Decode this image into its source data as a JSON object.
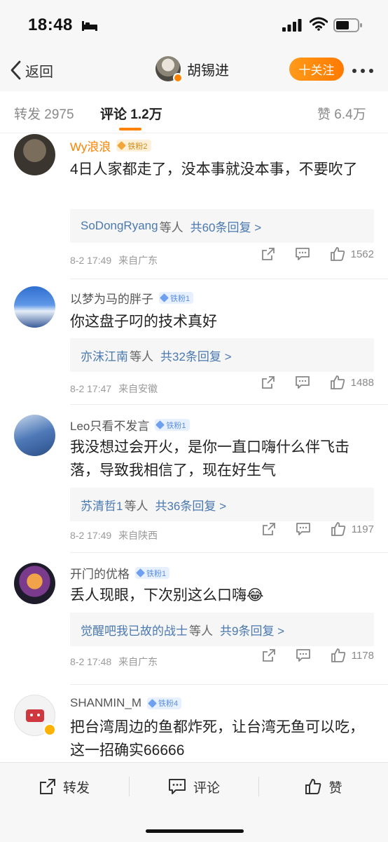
{
  "status_bar": {
    "time": "18:48"
  },
  "nav": {
    "back_label": "返回",
    "profile_name": "胡锡进",
    "follow_label": "十关注"
  },
  "tabs": {
    "repost_label": "转发",
    "repost_count": "2975",
    "comment_label": "评论",
    "comment_count": "1.2万",
    "like_label": "赞",
    "like_count": "6.4万"
  },
  "comments": [
    {
      "username": "Wy浪浪",
      "fan_badge": "铁粉2",
      "text": "4日人家都走了，没本事就没本事，不要吹了",
      "reply_user": "SoDongRyang",
      "reply_suffix": "等人",
      "reply_count": "共60条回复 >",
      "time": "8-2 17:49",
      "location": "来自广东",
      "likes": "1562"
    },
    {
      "username": "以梦为马的胖子",
      "fan_badge": "铁粉1",
      "text": "你这盘子叼的技术真好",
      "reply_user": "亦沫江南",
      "reply_suffix": "等人",
      "reply_count": "共32条回复 >",
      "time": "8-2 17:47",
      "location": "来自安徽",
      "likes": "1488"
    },
    {
      "username": "Leo只看不发言",
      "fan_badge": "铁粉1",
      "text": "我没想过会开火，是你一直口嗨什么伴飞击落，导致我相信了，现在好生气",
      "reply_user": "苏清哲1",
      "reply_suffix": "等人",
      "reply_count": "共36条回复 >",
      "time": "8-2 17:49",
      "location": "来自陕西",
      "likes": "1197"
    },
    {
      "username": "开门的优格",
      "fan_badge": "铁粉1",
      "text": "丢人现眼，下次别这么口嗨😂",
      "reply_user": "觉醒吧我已故的战士",
      "reply_suffix": "等人",
      "reply_count": "共9条回复 >",
      "time": "8-2 17:48",
      "location": "来自广东",
      "likes": "1178"
    },
    {
      "username": "SHANMIN_M",
      "fan_badge": "铁粉4",
      "text": "把台湾周边的鱼都炸死，让台湾无鱼可以吃，这一招确实66666"
    }
  ],
  "bottom_bar": {
    "repost_label": "转发",
    "comment_label": "评论",
    "like_label": "赞"
  }
}
